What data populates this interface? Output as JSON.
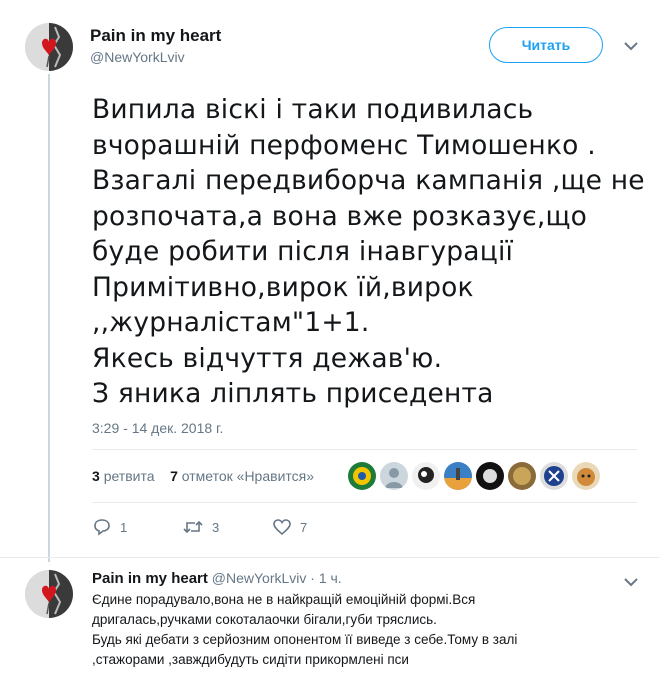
{
  "tweet": {
    "display_name": "Pain in my heart",
    "handle": "@NewYorkLviv",
    "follow_label": "Читать",
    "lines": [
      "Випила віскі і таки подивилась",
      "вчорашній перфоменс Тимошенко .",
      "Взагалі передвиборча кампанія ,ще не",
      "розпочата,а вона вже розказує,що",
      "буде робити після інавгурації",
      "Примітивно,вирок їй,вирок",
      ",,журналістам\"1+1.",
      "Якесь відчуття дежав'ю.",
      "З яника ліплять приседента"
    ],
    "timestamp": "3:29 - 14 дек. 2018 г.",
    "retweets_count": "3",
    "retweets_label": "ретвита",
    "likes_count": "7",
    "likes_label": "отметок «Нравится»",
    "actions": {
      "replies": "1",
      "retweets": "3",
      "likes": "7"
    },
    "accent_color": "#1da1f2"
  },
  "reply": {
    "display_name": "Pain in my heart",
    "handle": "@NewYorkLviv",
    "time": "· 1 ч.",
    "lines": [
      "Єдине порадувало,вона не в найкращій емоційній формі.Вся",
      "дригалась,ручками сокоталаочки бігали,губи тряслись.",
      "Будь які дебати з серйозним опонентом її виведе з себе.Тому в залі",
      ",стажорами ,завждибудуть сидіти прикормлені пси"
    ]
  }
}
